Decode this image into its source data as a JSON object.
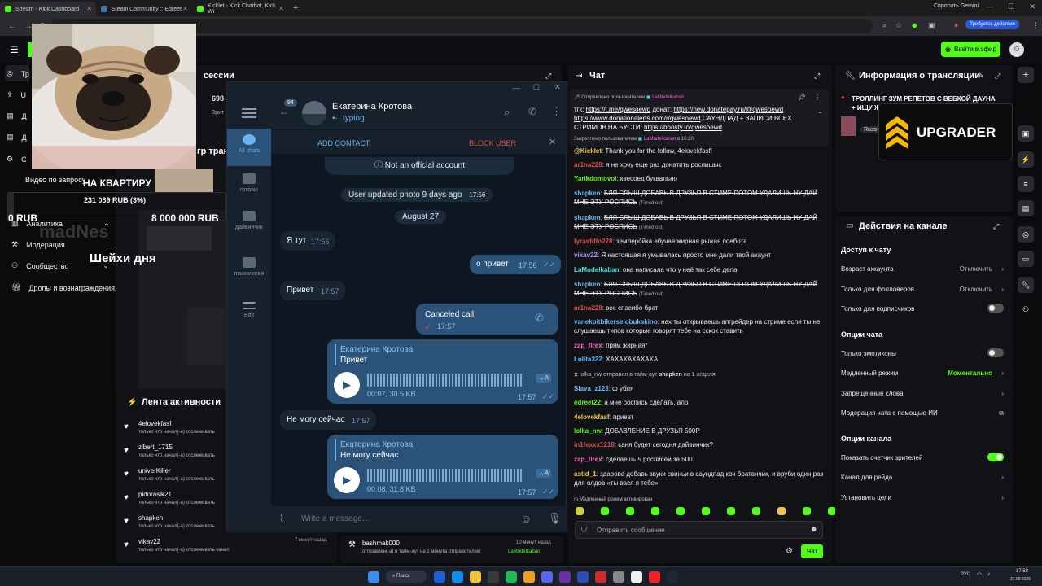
{
  "browser": {
    "tabs": [
      {
        "label": "Stream - Kick Dashboard",
        "color": "#53fc18"
      },
      {
        "label": "Steam Community :: Edreet",
        "color": "#1b2838"
      },
      {
        "label": "Kicklet - Kick Chatbot, Kick Wi",
        "color": "#53fc18"
      }
    ],
    "gemini": "Спросить Gemini",
    "update_badge": "Требуется действие"
  },
  "kick": {
    "go_live": "Выйти в эфир",
    "session_title_partial": "сессии",
    "session_stat": "698",
    "session_stat_label": "Зрит",
    "translation_partial": "гр трансл"
  },
  "left_nav": {
    "items": [
      "Аналитика",
      "Модерация",
      "Сообщество",
      "Дропы и вознаграждения"
    ],
    "short_items": [
      "Тр",
      "U",
      "Д",
      "Д",
      "С"
    ]
  },
  "overlay": {
    "video_request": "Видео по запросу",
    "goal_title": "НА КВАРТИРУ",
    "goal_amount": "231 039 RUB (3%)",
    "goal_left": "0 RUB",
    "goal_right": "8 000 000 RUB",
    "watermark": "madNes",
    "jokes": "Шейхи дня"
  },
  "activity": {
    "title": "Лента активности",
    "items": [
      {
        "name": "4elovekfasf",
        "sub": "только что начал(-а) отслеживать"
      },
      {
        "name": "zibert_1715",
        "sub": "только что начал(-а) отслеживать"
      },
      {
        "name": "univerKiller",
        "sub": "только что начал(-а) отслеживать"
      },
      {
        "name": "pidorasik21",
        "sub": "только что начал(-а) отслеживать"
      },
      {
        "name": "shapken",
        "sub": "только что начал(-а) отслеживать"
      },
      {
        "name": "vikav22",
        "sub": "только что начал(-а) отслеживать канал",
        "time": "7 минут назад"
      }
    ],
    "timeout_item": {
      "name": "bashmak000",
      "sub": "отправлен(-а) в тайм-аут на 1 минута отправителем",
      "by": "LaModelkaban",
      "time": "10 минут назад"
    }
  },
  "telegram": {
    "badge": "94",
    "contact_name": "Екатерина Кротова",
    "status": "typing",
    "add_contact": "ADD CONTACT",
    "block_user": "BLOCK USER",
    "sidebar": [
      {
        "label": "All chats"
      },
      {
        "label": "готовы"
      },
      {
        "label": "дайвинчик"
      },
      {
        "label": "психология"
      },
      {
        "label": "Edit"
      }
    ],
    "not_official": "Not an official account",
    "updated_photo": "User updated photo 9 days ago",
    "updated_photo_time": "17:56",
    "date_divider": "August 27",
    "messages": [
      {
        "text": "Я тут",
        "time": "17:56"
      },
      {
        "text": "о привет",
        "time": "17:56"
      },
      {
        "text": "Привет",
        "time": "17:57"
      },
      {
        "text": "Canceled call",
        "time": "17:57"
      },
      {
        "quote_name": "Екатерина Кротова",
        "quote_text": "Привет",
        "duration": "00:07, 30.5 KB",
        "time": "17:57",
        "lang": "→A"
      },
      {
        "text": "Не могу сейчас",
        "time": "17:57"
      },
      {
        "quote_name": "Екатерина Кротова",
        "quote_text": "Не могу сейчас",
        "duration": "00:08, 31.8 KB",
        "time": "17:57",
        "lang": "→A"
      }
    ],
    "input_placeholder": "Write a message..."
  },
  "chat": {
    "title": "Чат",
    "pinned_sender_label": "Отправлено пользователем",
    "pinned_sender": "LaModelkaban",
    "pinned_prefix": "тгк:",
    "pinned_link1": "https://t.me/qwesoewd",
    "pinned_donate": "донат:",
    "pinned_link2": "https://new.donatepay.ru/@qwesoewd",
    "pinned_link3": "https://www.donationalerts.com/r/qwesoewd",
    "pinned_mid": "САУНДПАД + ЗАПИСИ ВСЕХ СТРИМОВ НА БУСТИ:",
    "pinned_link4": "https://boosty.to/qwesoewd",
    "pinned_by_label": "Закреплено пользователем",
    "pinned_by": "LaModelkaban",
    "pinned_time": "в 16:20",
    "messages": [
      {
        "user": "@Kicklet",
        "text": "Thank you for the follow, 4elovekfasf!",
        "cls": "u-yellow"
      },
      {
        "user": "ar1na228",
        "text": "я не хочу еще раз донатить роспишыс",
        "cls": "u-red"
      },
      {
        "user": "Yarikdomovoi",
        "text": "квесоед буквально",
        "cls": "u-green"
      },
      {
        "user": "shapken",
        "text": "БЛЯ СЛЫШ ДОБАВЬ В ДРУЗЬЯ В СТИМЕ ПОТОМ УДАЛИШЬ НУ ДАЙ МНЕ ЭТУ РОСПИСЬ",
        "cls": "u-blue",
        "strike": true,
        "timeout": "(Timed out)"
      },
      {
        "user": "shapken",
        "text": "БЛЯ СЛЫШ ДОБАВЬ В ДРУЗЬЯ В СТИМЕ ПОТОМ УДАЛИШЬ НУ ДАЙ МНЕ ЭТУ РОСПИСЬ",
        "cls": "u-blue",
        "strike": true,
        "timeout": "(Timed out)"
      },
      {
        "user": "fyrasfdfo228",
        "text": "землерóйка ебучая жирная рыжая поебота",
        "cls": "u-red"
      },
      {
        "user": "vikav22",
        "text": "Я настоящая я умывалась просто мне дали твой акаунт",
        "cls": "u-purple"
      },
      {
        "user": "LaModelkaban",
        "text": "она написала что у неё так себе дела",
        "cls": "u-cyan"
      },
      {
        "user": "shapken",
        "text": "БЛЯ СЛЫШ ДОБАВЬ В ДРУЗЬЯ В СТИМЕ ПОТОМ УДАЛИШЬ НУ ДАЙ МНЕ ЭТУ РОСПИСЬ",
        "cls": "u-blue",
        "strike": true,
        "timeout": "(Timed out)"
      },
      {
        "user": "ar1na228",
        "text": "все спасибо брат",
        "cls": "u-red"
      },
      {
        "user": "vanekpitbikerselobukakino",
        "text": "нах ты открываешь апгрейдер на стриме если ты не слушаешь типов которые говорят тебе на сскок ставить",
        "cls": "u-blue"
      },
      {
        "user": "zap_firex",
        "text": "прям жирная*",
        "cls": "u-pink"
      },
      {
        "user": "Lolita322",
        "text": "ХАХАХАХАХАХА",
        "cls": "u-blue"
      },
      {
        "user": "lolka_nw",
        "text": "отправил в тайм-аут",
        "target": "shapken",
        "dur": "на 1 неделя",
        "system": true
      },
      {
        "user": "Slava_z123",
        "text": "ф убля",
        "cls": "u-blue"
      },
      {
        "user": "edreet22",
        "text": "а мне роспись сделать, ало",
        "cls": "u-green"
      },
      {
        "user": "4elovekfasf",
        "text": "привет",
        "cls": "u-yellow"
      },
      {
        "user": "lolka_nw",
        "text": "ДОБАВЛЕНИЕ В ДРУЗЬЯ 500Р",
        "cls": "u-green"
      },
      {
        "user": "in1fexxx1218",
        "text": "саня будет сегодня дайвинчик?",
        "cls": "u-red"
      },
      {
        "user": "zap_firex",
        "text": "сделаешь 5 росписей за 500",
        "cls": "u-pink"
      },
      {
        "user": "astid_1",
        "text": "здарова добавь звуки свиньи в саундпад коч братанчик, и вруби один раз для олдов «ты вася я тебе»",
        "cls": "u-yellow"
      }
    ],
    "slow_mode": "Медленный режим активирован",
    "input_placeholder": "Отправить сообщение",
    "send": "Чат"
  },
  "stream_info": {
    "title": "Информация о трансляции",
    "stream_title": "ТРОЛЛИНГ ЗУМ РЕПЕТОВ С ВЕБКОЙ ДАУНА + ИЩУ ЖИРУХ",
    "lang_tag": "Russ",
    "sponsor": "UPGRADER"
  },
  "channel_actions": {
    "title": "Действия на канале",
    "sections": [
      {
        "title": "Доступ к чату",
        "rows": [
          {
            "label": "Возраст аккаунта",
            "value": "Отключить",
            "kind": "chev"
          },
          {
            "label": "Только для фолловеров",
            "value": "Отключить",
            "kind": "chev"
          },
          {
            "label": "Только для подписчиков",
            "kind": "toggle",
            "on": false
          }
        ]
      },
      {
        "title": "Опции чата",
        "rows": [
          {
            "label": "Только эмотиконы",
            "kind": "toggle",
            "on": false
          },
          {
            "label": "Медленный режим",
            "value": "Моментально",
            "kind": "chev",
            "green": true
          },
          {
            "label": "Запрещенные слова",
            "kind": "chev"
          },
          {
            "label": "Модерация чата с помощью ИИ",
            "kind": "ext"
          }
        ]
      },
      {
        "title": "Опции канала",
        "rows": [
          {
            "label": "Показать счетчик зрителей",
            "kind": "toggle",
            "on": true
          },
          {
            "label": "Канал для рейда",
            "kind": "chev"
          },
          {
            "label": "Установить цели",
            "kind": "chev"
          }
        ]
      }
    ]
  },
  "taskbar": {
    "search": "Поиск",
    "lang": "РУС",
    "time": "17:58",
    "date": "27.08.2026"
  }
}
